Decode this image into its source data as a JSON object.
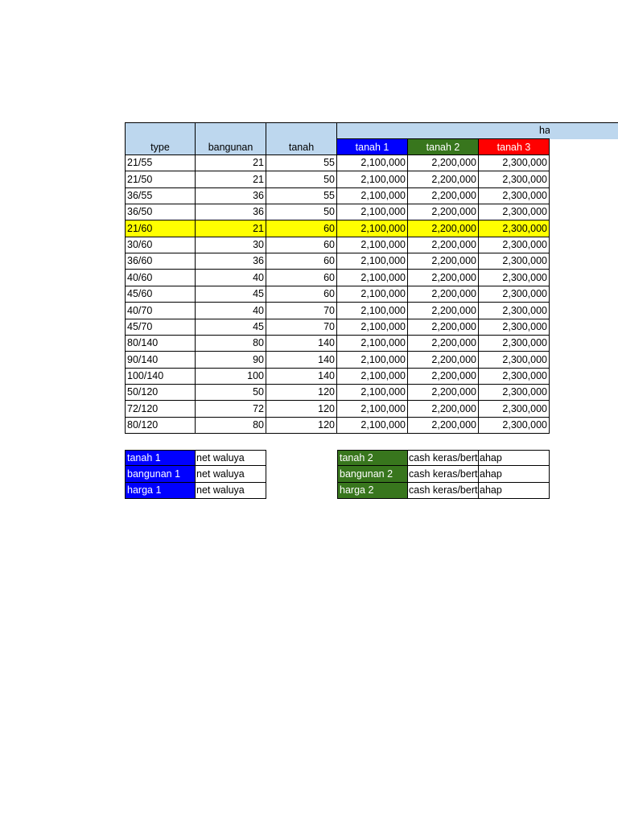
{
  "header": {
    "group_label": "ha",
    "columns": [
      "type",
      "bangunan",
      "tanah",
      "tanah 1",
      "tanah 2",
      "tanah 3"
    ],
    "colors": {
      "tanah 1": "#0000ff",
      "tanah 2": "#38761d",
      "tanah 3": "#ff0000",
      "header_bg": "#bdd7ee",
      "highlight": "#ffff00"
    }
  },
  "rows": [
    [
      "21/55",
      "21",
      "55",
      "2,100,000",
      "2,200,000",
      "2,300,000"
    ],
    [
      "21/50",
      "21",
      "50",
      "2,100,000",
      "2,200,000",
      "2,300,000"
    ],
    [
      "36/55",
      "36",
      "55",
      "2,100,000",
      "2,200,000",
      "2,300,000"
    ],
    [
      "36/50",
      "36",
      "50",
      "2,100,000",
      "2,200,000",
      "2,300,000"
    ],
    [
      "21/60",
      "21",
      "60",
      "2,100,000",
      "2,200,000",
      "2,300,000"
    ],
    [
      "30/60",
      "30",
      "60",
      "2,100,000",
      "2,200,000",
      "2,300,000"
    ],
    [
      "36/60",
      "36",
      "60",
      "2,100,000",
      "2,200,000",
      "2,300,000"
    ],
    [
      "40/60",
      "40",
      "60",
      "2,100,000",
      "2,200,000",
      "2,300,000"
    ],
    [
      "45/60",
      "45",
      "60",
      "2,100,000",
      "2,200,000",
      "2,300,000"
    ],
    [
      "40/70",
      "40",
      "70",
      "2,100,000",
      "2,200,000",
      "2,300,000"
    ],
    [
      "45/70",
      "45",
      "70",
      "2,100,000",
      "2,200,000",
      "2,300,000"
    ],
    [
      "80/140",
      "80",
      "140",
      "2,100,000",
      "2,200,000",
      "2,300,000"
    ],
    [
      "90/140",
      "90",
      "140",
      "2,100,000",
      "2,200,000",
      "2,300,000"
    ],
    [
      "100/140",
      "100",
      "140",
      "2,100,000",
      "2,200,000",
      "2,300,000"
    ],
    [
      "50/120",
      "50",
      "120",
      "2,100,000",
      "2,200,000",
      "2,300,000"
    ],
    [
      "72/120",
      "72",
      "120",
      "2,100,000",
      "2,200,000",
      "2,300,000"
    ],
    [
      "80/120",
      "80",
      "120",
      "2,100,000",
      "2,200,000",
      "2,300,000"
    ]
  ],
  "highlighted_row": 4,
  "legend_left": [
    [
      "tanah 1",
      "net waluya"
    ],
    [
      "bangunan 1",
      "net waluya"
    ],
    [
      "harga 1",
      "net waluya"
    ]
  ],
  "legend_right": [
    [
      "tanah 2",
      "cash keras/bert",
      "ahap"
    ],
    [
      "bangunan 2",
      "cash keras/bert",
      "ahap"
    ],
    [
      "harga 2",
      "cash keras/bert",
      "ahap"
    ]
  ]
}
